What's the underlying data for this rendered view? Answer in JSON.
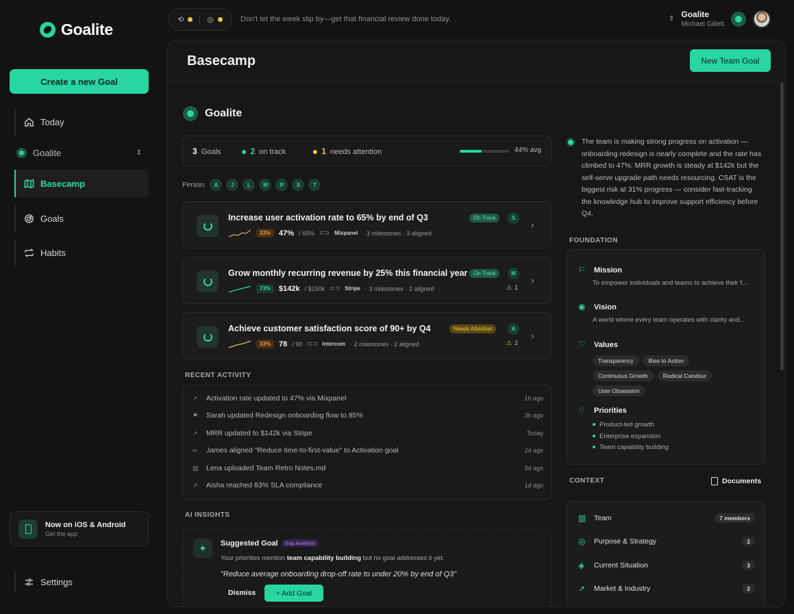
{
  "brand": {
    "name": "Goalite"
  },
  "sidebar": {
    "create_label": "Create a new Goal",
    "nav": [
      {
        "label": "Today",
        "icon": "home-icon"
      },
      {
        "label": "Basecamp",
        "icon": "map-icon",
        "active": true
      },
      {
        "label": "Goals",
        "icon": "target-icon"
      },
      {
        "label": "Habits",
        "icon": "repeat-icon"
      }
    ],
    "workspace": "Goalite",
    "app_promo": {
      "title": "Now on iOS & Android",
      "subtitle": "Get the app"
    },
    "settings_label": "Settings"
  },
  "topbar": {
    "message": "Don't let the week slip by—get that financial review done today.",
    "user": {
      "org": "Goalite",
      "name": "Michael Gillett"
    }
  },
  "main": {
    "title": "Basecamp",
    "new_goal_label": "New Team Goal",
    "workspace_title": "Goalite",
    "stats": {
      "goals": "3",
      "goals_label": "Goals",
      "on_track": "2",
      "on_track_label": "on track",
      "attention": "1",
      "attention_label": "needs attention",
      "avg_progress": 0.44,
      "avg_label": "44% avg"
    },
    "person_label": "Person:",
    "people": [
      "A",
      "J",
      "L",
      "M",
      "P",
      "S",
      "T"
    ],
    "goals": [
      {
        "title": "Increase user activation rate to 65% by end of Q3",
        "pct": "33%",
        "current": "47%",
        "target": "/ 65%",
        "source": "Mixpanel",
        "meta": "· 3 milestones · 3 aligned",
        "status": "On Track",
        "owner": "S",
        "warnings": ""
      },
      {
        "title": "Grow monthly recurring revenue by 25% this financial year",
        "pct": "73%",
        "current": "$142k",
        "target": "/ $150k",
        "source": "Stripe",
        "meta": "· 3 milestones · 2 aligned",
        "status": "On Track",
        "owner": "M",
        "warnings": "1"
      },
      {
        "title": "Achieve customer satisfaction score of 90+ by Q4",
        "pct": "33%",
        "current": "78",
        "target": "/ 90",
        "source": "Intercom",
        "meta": "· 2 milestones · 2 aligned",
        "status": "Needs Attention",
        "owner": "A",
        "warnings": "2"
      }
    ],
    "recent_activity_label": "RECENT ACTIVITY",
    "activity": [
      {
        "text": "Activation rate updated to 47% via Mixpanel",
        "time": "1h ago",
        "icon": "trend-icon"
      },
      {
        "text": "Sarah updated Redesign onboarding flow to 85%",
        "time": "3h ago",
        "icon": "flag-icon"
      },
      {
        "text": "MRR updated to $142k via Stripe",
        "time": "Today",
        "icon": "trend-icon"
      },
      {
        "text": "James aligned \"Reduce time-to-first-value\" to Activation goal",
        "time": "2d ago",
        "icon": "link-icon"
      },
      {
        "text": "Lena uploaded Team Retro Notes.md",
        "time": "3d ago",
        "icon": "file-icon"
      },
      {
        "text": "Aisha reached 83% SLA compliance",
        "time": "1d ago",
        "icon": "trend-icon"
      }
    ],
    "ai_insights_label": "AI INSIGHTS",
    "insight": {
      "title": "Suggested Goal",
      "tag": "Gap Analysis",
      "body_pre": "Your priorities mention ",
      "body_bold": "team capability building",
      "body_post": " but no goal addresses it yet.",
      "quote": "\"Reduce average onboarding drop-off rate to under 20% by end of Q3\"",
      "dismiss": "Dismiss",
      "add": "+ Add Goal"
    }
  },
  "right": {
    "summary": "The team is making strong progress on activation — onboarding redesign is nearly complete and the rate has climbed to 47%. MRR growth is steady at $142k but the self-serve upgrade path needs resourcing. CSAT is the biggest risk at 31% progress — consider fast-tracking the knowledge hub to improve support efficiency before Q4.",
    "foundation_label": "FOUNDATION",
    "mission": {
      "label": "Mission",
      "text": "To empower individuals and teams to achieve their f..."
    },
    "vision": {
      "label": "Vision",
      "text": "A world where every team operates with clarity and..."
    },
    "values_label": "Values",
    "values": [
      "Transparency",
      "Bias to Action",
      "Continuous Growth",
      "Radical Candour",
      "User Obsession"
    ],
    "priorities_label": "Priorities",
    "priorities": [
      "Product-led growth",
      "Enterprise expansion",
      "Team capability building"
    ],
    "context_label": "CONTEXT",
    "documents_label": "Documents",
    "context": [
      {
        "label": "Team",
        "count": "7 members"
      },
      {
        "label": "Purpose & Strategy",
        "count": "2"
      },
      {
        "label": "Current Situation",
        "count": "3"
      },
      {
        "label": "Market & Industry",
        "count": "2"
      }
    ]
  },
  "colors": {
    "accent": "#29d6a1",
    "warning": "#f2c744",
    "background": "#131313"
  }
}
